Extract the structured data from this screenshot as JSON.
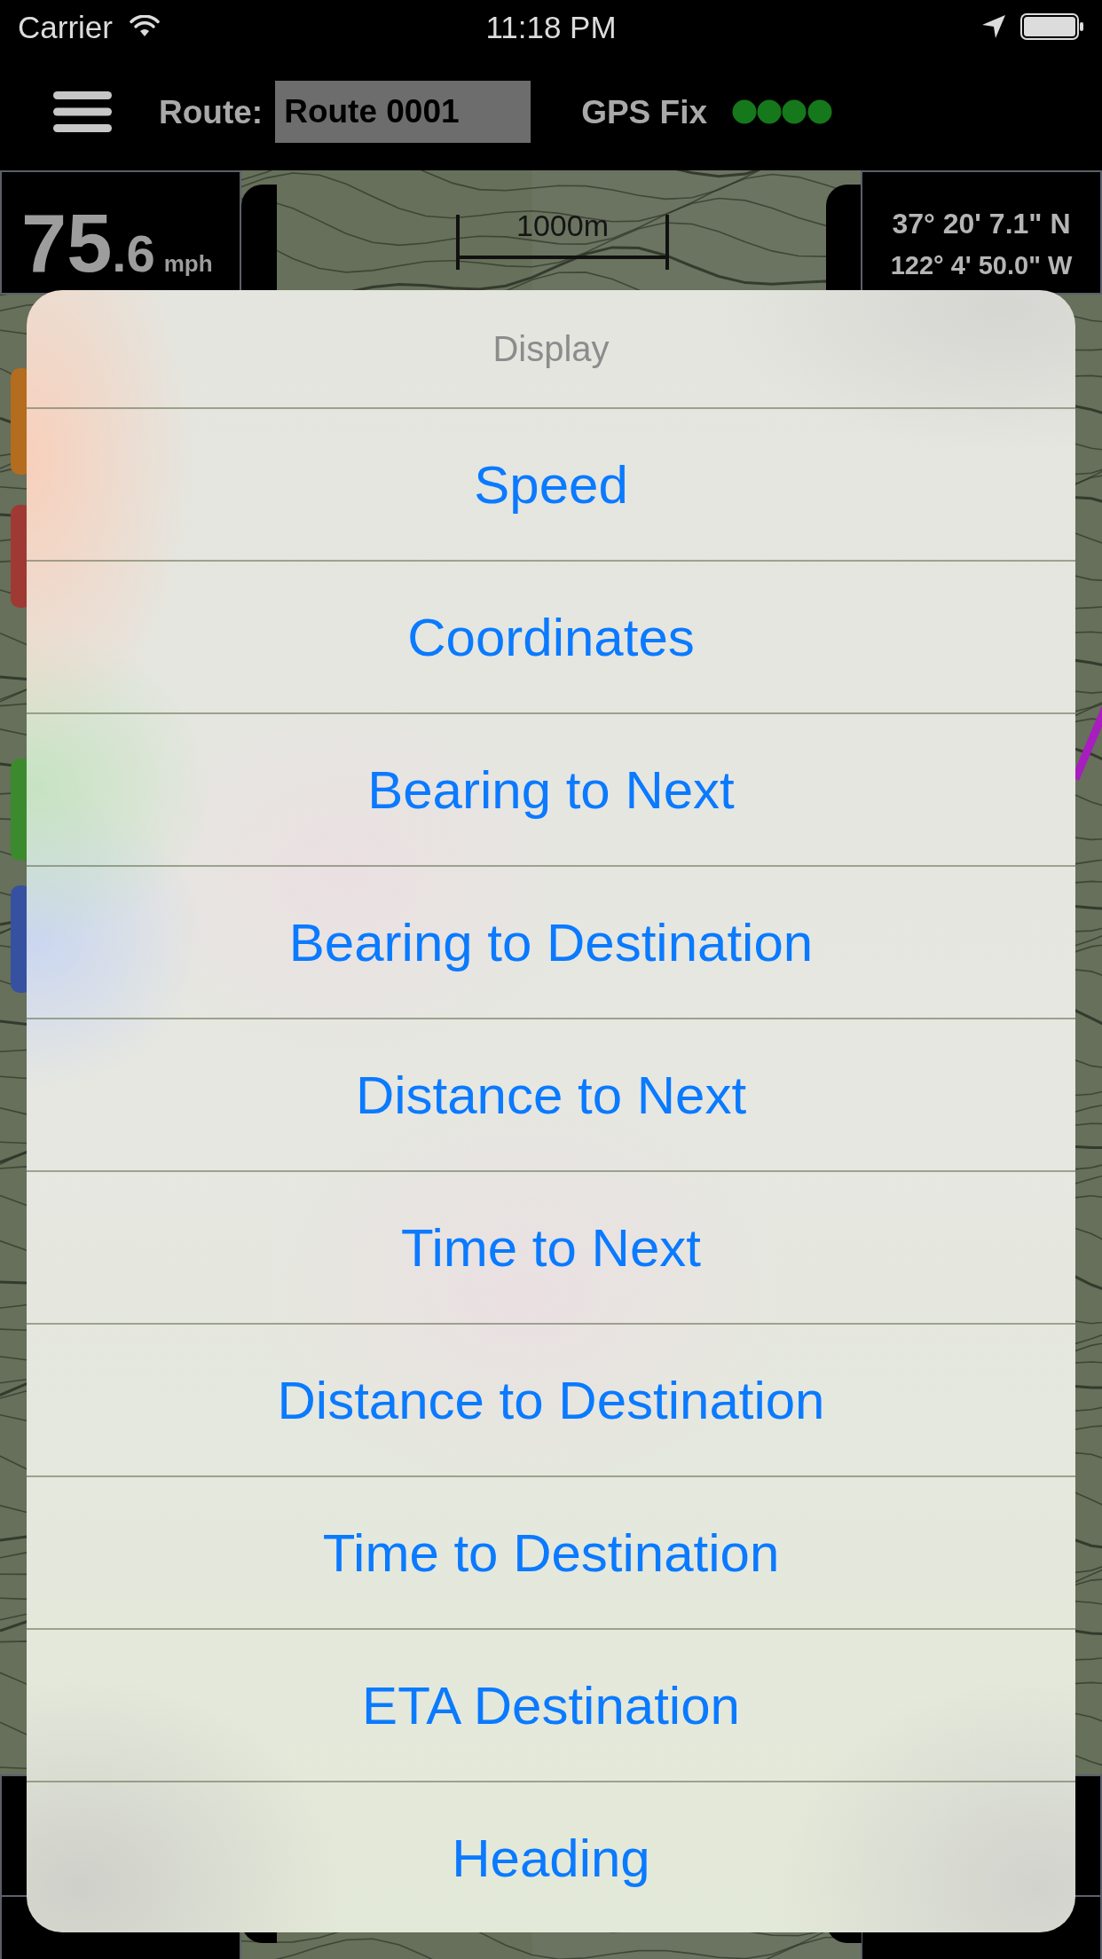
{
  "status_bar": {
    "carrier": "Carrier",
    "time": "11:18 PM"
  },
  "header": {
    "route": {
      "label": "Route:",
      "value": "Route 0001"
    },
    "gps": {
      "label": "GPS Fix"
    }
  },
  "speed_panel": {
    "whole": "75",
    "fraction": ".6",
    "unit": "mph"
  },
  "scale_bar": {
    "label": "1000m"
  },
  "coordinates_panel": {
    "latitude": "37° 20' 7.1\" N",
    "longitude": "122° 4' 50.0\" W"
  },
  "action_sheet": {
    "title": "Display",
    "options": [
      "Speed",
      "Coordinates",
      "Bearing to Next",
      "Bearing to Destination",
      "Distance to Next",
      "Time to Next",
      "Distance to Destination",
      "Time to Destination",
      "ETA Destination",
      "Heading"
    ]
  }
}
